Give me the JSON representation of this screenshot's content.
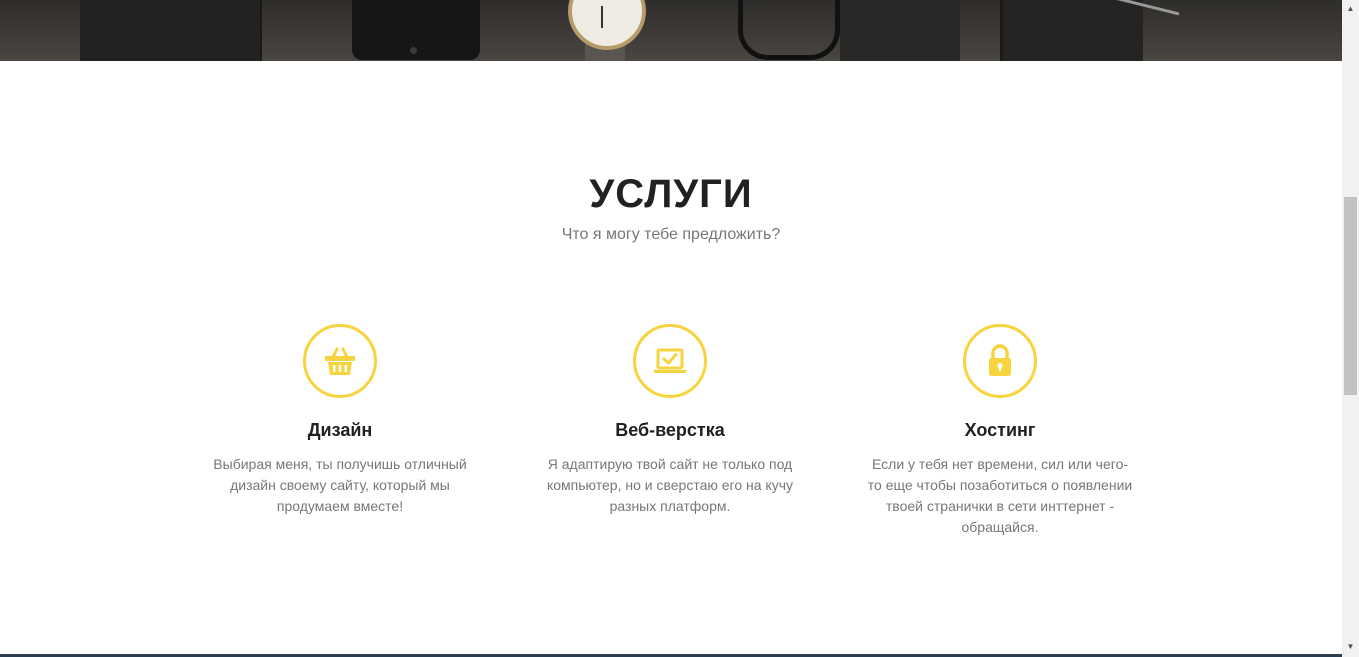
{
  "section": {
    "title": "УСЛУГИ",
    "subtitle": "Что я могу тебе предложить?"
  },
  "services": [
    {
      "icon": "basket-icon",
      "title": "Дизайн",
      "text": "Выбирая меня, ты получишь отличный дизайн своему сайту, который мы продумаем вместе!"
    },
    {
      "icon": "laptop-check-icon",
      "title": "Веб-верстка",
      "text": "Я адаптирую твой сайт не только под компьютер, но и сверстаю его на кучу разных платформ."
    },
    {
      "icon": "lock-icon",
      "title": "Хостинг",
      "text": "Если у тебя нет времени, сил или чего-то еще чтобы позаботиться о появлении твоей странички в сети инттернет - обращайся."
    }
  ],
  "colors": {
    "accent": "#f7d33e",
    "heading": "#212121",
    "muted": "#777777",
    "footer_line": "#2c3e50"
  }
}
